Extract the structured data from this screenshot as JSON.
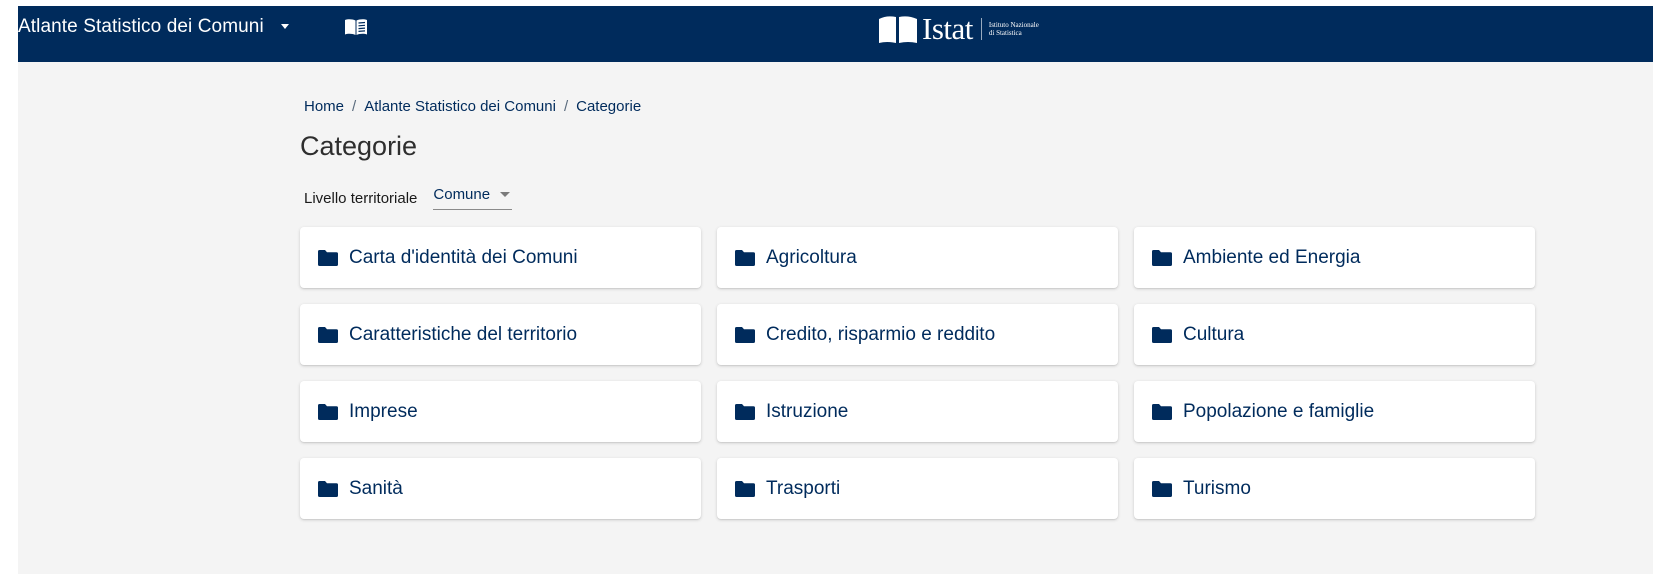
{
  "header": {
    "app_title": "Atlante Statistico dei Comuni",
    "dropdown_icon": "caret-down-icon",
    "book_icon": "book-icon",
    "logo": {
      "word": "Istat",
      "subtitle": "Istituto Nazionale\ndi Statistica"
    }
  },
  "breadcrumb": {
    "items": [
      "Home",
      "Atlante Statistico dei Comuni",
      "Categorie"
    ],
    "separator": "/"
  },
  "page": {
    "title": "Categorie"
  },
  "filter": {
    "label": "Livello territoriale",
    "selected": "Comune"
  },
  "categories": [
    {
      "label": "Carta d'identità dei Comuni",
      "icon": "folder-icon"
    },
    {
      "label": "Agricoltura",
      "icon": "folder-icon"
    },
    {
      "label": "Ambiente ed Energia",
      "icon": "folder-icon"
    },
    {
      "label": "Caratteristiche del territorio",
      "icon": "folder-icon"
    },
    {
      "label": "Credito, risparmio e reddito",
      "icon": "folder-icon"
    },
    {
      "label": "Cultura",
      "icon": "folder-icon"
    },
    {
      "label": "Imprese",
      "icon": "folder-icon"
    },
    {
      "label": "Istruzione",
      "icon": "folder-icon"
    },
    {
      "label": "Popolazione e famiglie",
      "icon": "folder-icon"
    },
    {
      "label": "Sanità",
      "icon": "folder-icon"
    },
    {
      "label": "Trasporti",
      "icon": "folder-icon"
    },
    {
      "label": "Turismo",
      "icon": "folder-icon"
    }
  ],
  "colors": {
    "header_bg": "#002b5c",
    "accent": "#002b5c",
    "page_bg": "#f4f4f4",
    "card_bg": "#ffffff"
  }
}
